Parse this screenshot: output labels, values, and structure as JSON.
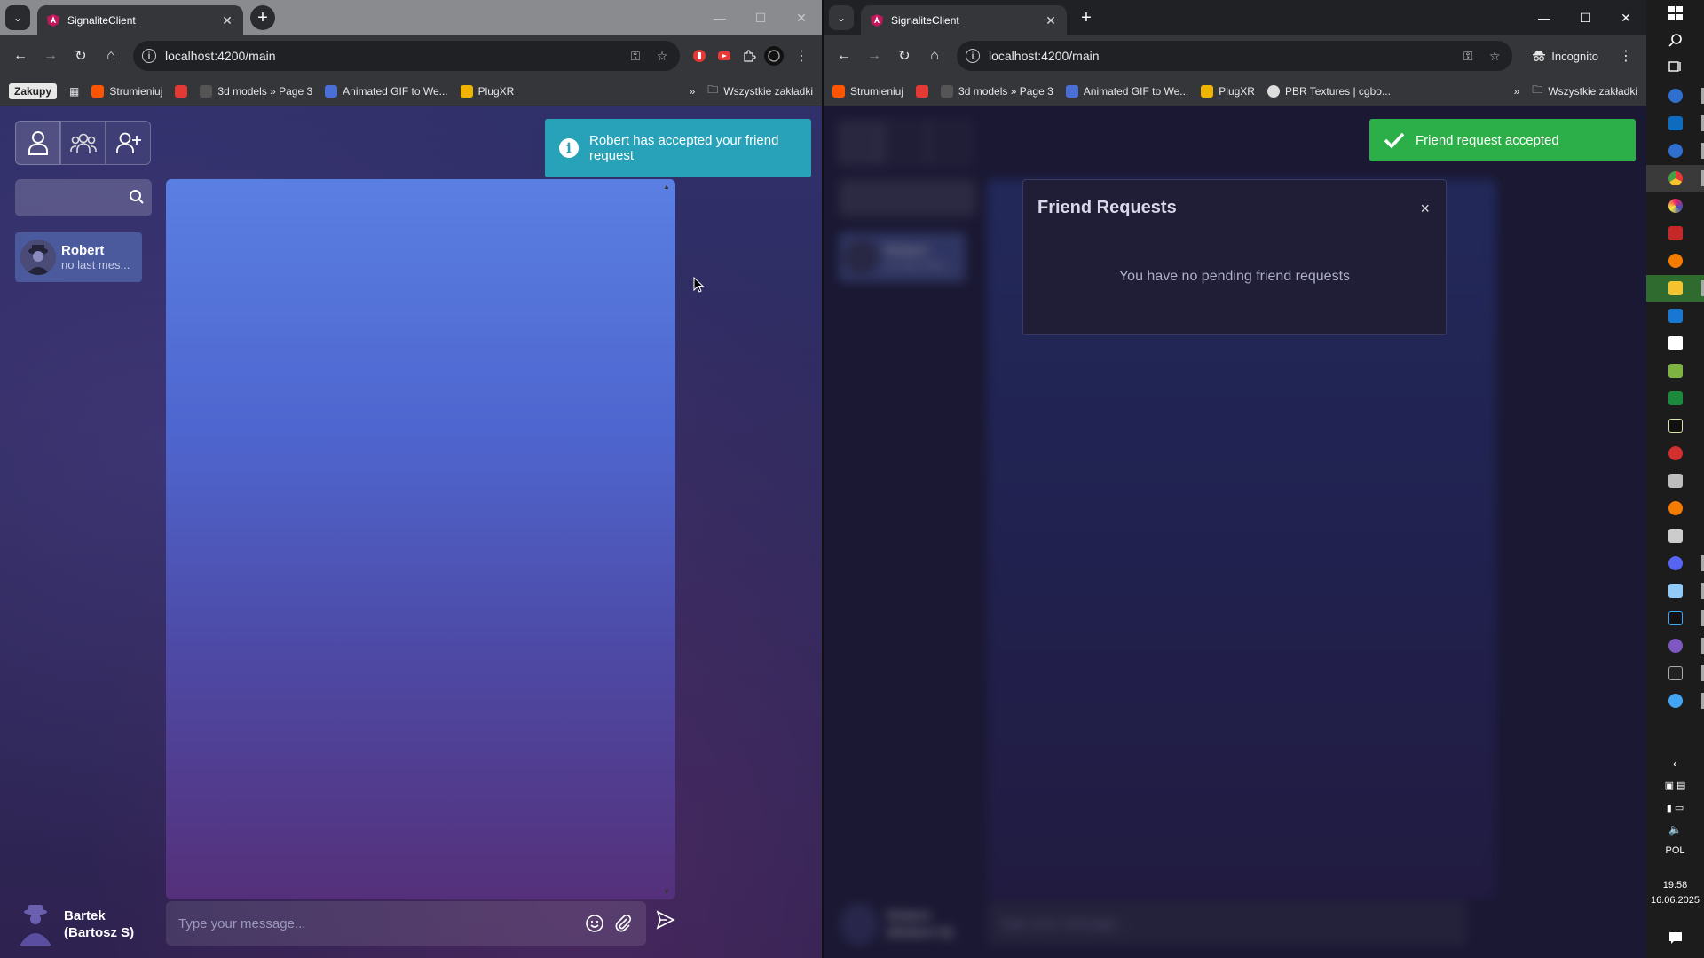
{
  "left_window": {
    "tab_title": "SignaliteClient",
    "url": "localhost:4200/main",
    "bookmarks": [
      "Zakupy",
      "Strumieniuj",
      "3d models » Page 3",
      "Animated GIF to We...",
      "PlugXR"
    ],
    "all_bookmarks": "Wszystkie zakładki",
    "app": {
      "contact_name": "Robert",
      "contact_last": "no last mes...",
      "me_name_line1": "Bartek",
      "me_name_line2": "(Bartosz S)",
      "message_placeholder": "Type your message...",
      "toast_text": "Robert has accepted your friend request"
    }
  },
  "right_window": {
    "tab_title": "SignaliteClient",
    "url": "localhost:4200/main",
    "incognito_label": "Incognito",
    "bookmarks": [
      "Strumieniuj",
      "3d models » Page 3",
      "Animated GIF to We...",
      "PlugXR",
      "PBR Textures | cgbo..."
    ],
    "all_bookmarks": "Wszystkie zakładki",
    "toast_text": "Friend request accepted",
    "modal": {
      "title": "Friend Requests",
      "close": "×",
      "body": "You have no pending friend requests"
    },
    "background_app": {
      "contact_name": "Robert",
      "contact_last": "no last mes...",
      "me_name_line1": "Robert",
      "me_name_line2": "(Robert G)",
      "message_placeholder": "Type your message..."
    }
  },
  "taskbar": {
    "language": "POL",
    "time": "19:58",
    "date": "16.06.2025"
  },
  "colors": {
    "info_toast": "#27a2b8",
    "success_toast": "#2cae48",
    "chat_gradient_top": "#5a7fe2",
    "chat_gradient_bottom": "#55307a",
    "contact_bg": "#4a5a9c"
  }
}
